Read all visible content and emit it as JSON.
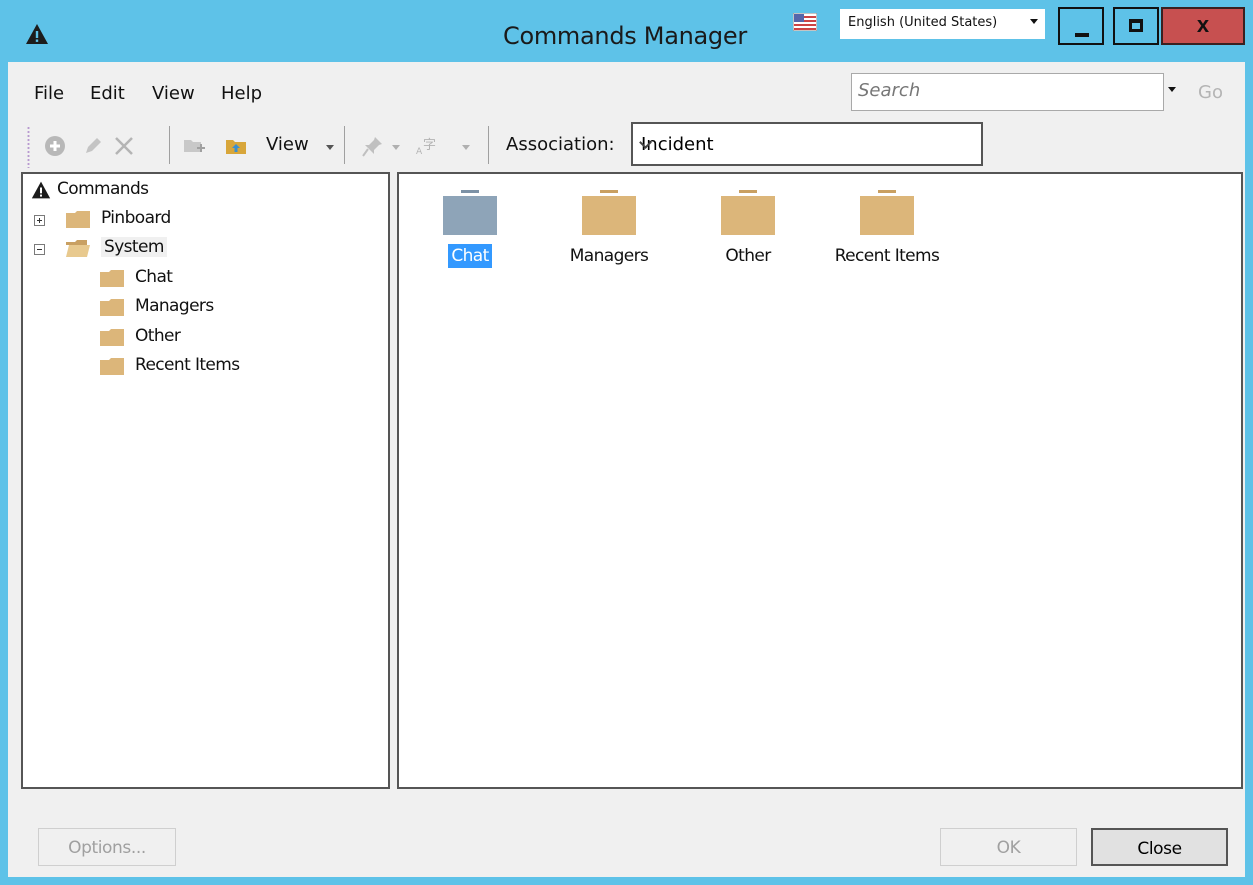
{
  "window": {
    "title": "Commands Manager",
    "language": "English (United States)",
    "close_glyph": "x"
  },
  "menu": {
    "items": [
      "File",
      "Edit",
      "View",
      "Help"
    ]
  },
  "search": {
    "placeholder": "Search",
    "go_label": "Go"
  },
  "toolbar": {
    "view_label": "View",
    "association_label": "Association:",
    "association_value": "Incident"
  },
  "tree": {
    "root": "Commands",
    "nodes": [
      {
        "label": "Pinboard",
        "expanded": false
      },
      {
        "label": "System",
        "expanded": true,
        "children": [
          "Chat",
          "Managers",
          "Other",
          "Recent Items"
        ]
      }
    ]
  },
  "content": {
    "items": [
      {
        "label": "Chat",
        "selected": true
      },
      {
        "label": "Managers",
        "selected": false
      },
      {
        "label": "Other",
        "selected": false
      },
      {
        "label": "Recent Items",
        "selected": false
      }
    ]
  },
  "buttons": {
    "options": "Options...",
    "ok": "OK",
    "close": "Close"
  },
  "colors": {
    "titlebar": "#5ec2e8",
    "close_button": "#c75050",
    "selection": "#3399ff",
    "folder": "#dcb67a",
    "folder_selected": "#8ea4b8"
  }
}
